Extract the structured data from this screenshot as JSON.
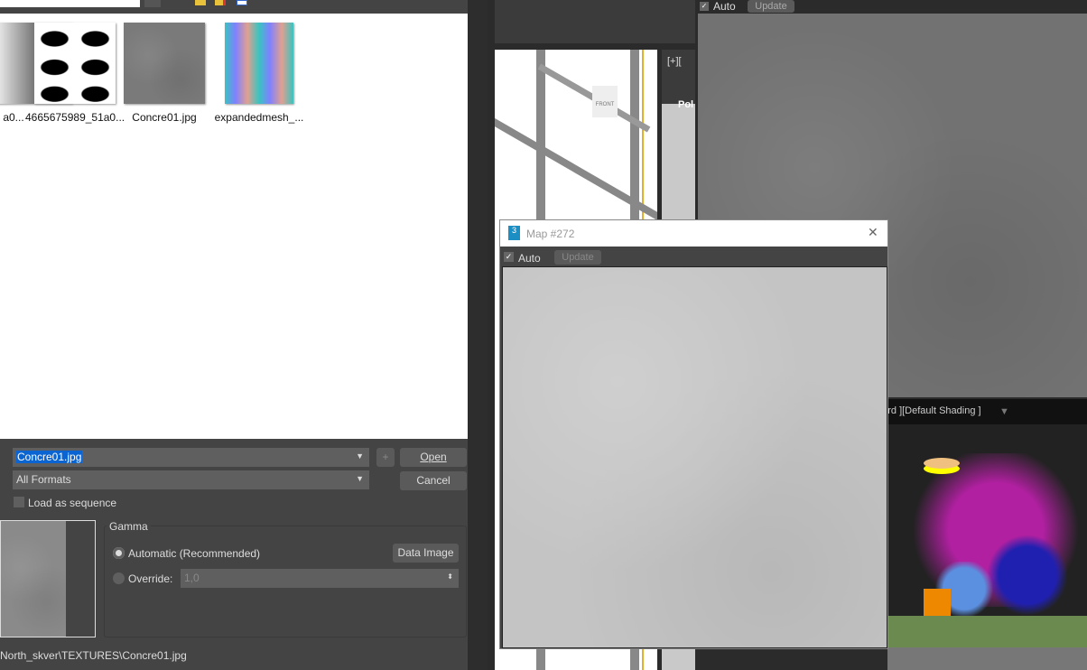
{
  "file_dialog": {
    "files": [
      {
        "name": "a0..."
      },
      {
        "name": "4665675989_51a0..."
      },
      {
        "name": "Concre01.jpg"
      },
      {
        "name": "expandedmesh_..."
      }
    ],
    "filename": "Concre01.jpg",
    "format": "All Formats",
    "add_label": "+",
    "open_label": "Open",
    "cancel_label": "Cancel",
    "load_sequence_label": "Load as sequence",
    "gamma": {
      "title": "Gamma",
      "automatic_label": "Automatic (Recommended)",
      "override_label": "Override:",
      "override_value": "1,0",
      "data_image_label": "Data Image"
    },
    "path": "North_skver\\TEXTURES\\Concre01.jpg"
  },
  "viewport": {
    "menu": "[+][",
    "label": "Pol",
    "cube_label": "FRONT"
  },
  "bg_preview": {
    "auto_label": "Auto",
    "update_label": "Update"
  },
  "scene_viewport": {
    "label": "dard ][Default Shading ]"
  },
  "map_window": {
    "title": "Map #272",
    "icon_text": "3",
    "auto_label": "Auto",
    "update_label": "Update",
    "close": "✕"
  }
}
